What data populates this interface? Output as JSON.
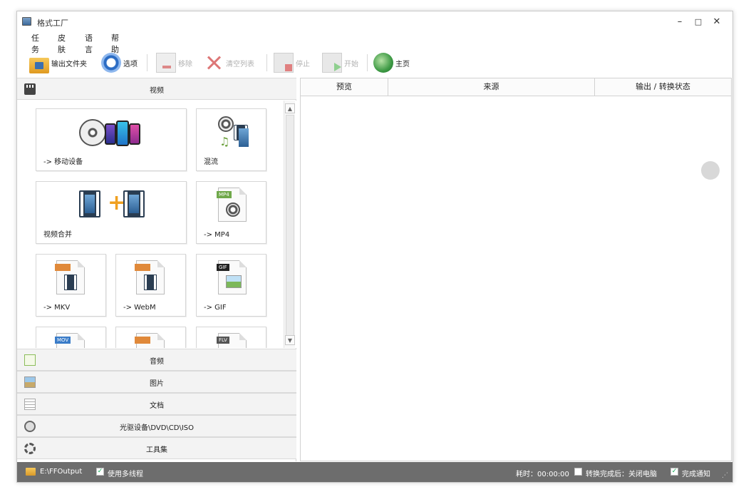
{
  "window": {
    "title": "格式工厂",
    "controls": {
      "minimize": "–",
      "maximize": "□",
      "close": "✕"
    }
  },
  "menu": [
    "任务",
    "皮肤",
    "语言",
    "帮助"
  ],
  "toolbar": {
    "output_folder": "输出文件夹",
    "options": "选项",
    "remove": "移除",
    "clear_list": "清空列表",
    "stop": "停止",
    "start": "开始",
    "home": "主页"
  },
  "categories": {
    "video": "视频",
    "audio": "音频",
    "image": "图片",
    "document": "文档",
    "disc": "光驱设备\\DVD\\CD\\ISO",
    "tools": "工具集"
  },
  "video_tiles": {
    "mobile": "-> 移动设备",
    "mux": "混流",
    "merge": "视频合并",
    "mp4": "-> MP4",
    "mkv": "-> MKV",
    "webm": "-> WebM",
    "gif": "-> GIF",
    "badges": {
      "mp4": "MP4",
      "gif": "GIF",
      "mov": "MOV",
      "flv": "FLV"
    }
  },
  "columns": {
    "preview": "预览",
    "source": "来源",
    "status": "输出 / 转换状态"
  },
  "statusbar": {
    "output_path": "E:\\FFOutput",
    "multithread": "使用多线程",
    "elapsed": "耗时：00:00:00",
    "after_done": "转换完成后：关闭电脑",
    "notify": "完成通知"
  },
  "colors": {
    "statusbar_bg": "#6d6d6d",
    "accent": "#2b6cc4"
  }
}
